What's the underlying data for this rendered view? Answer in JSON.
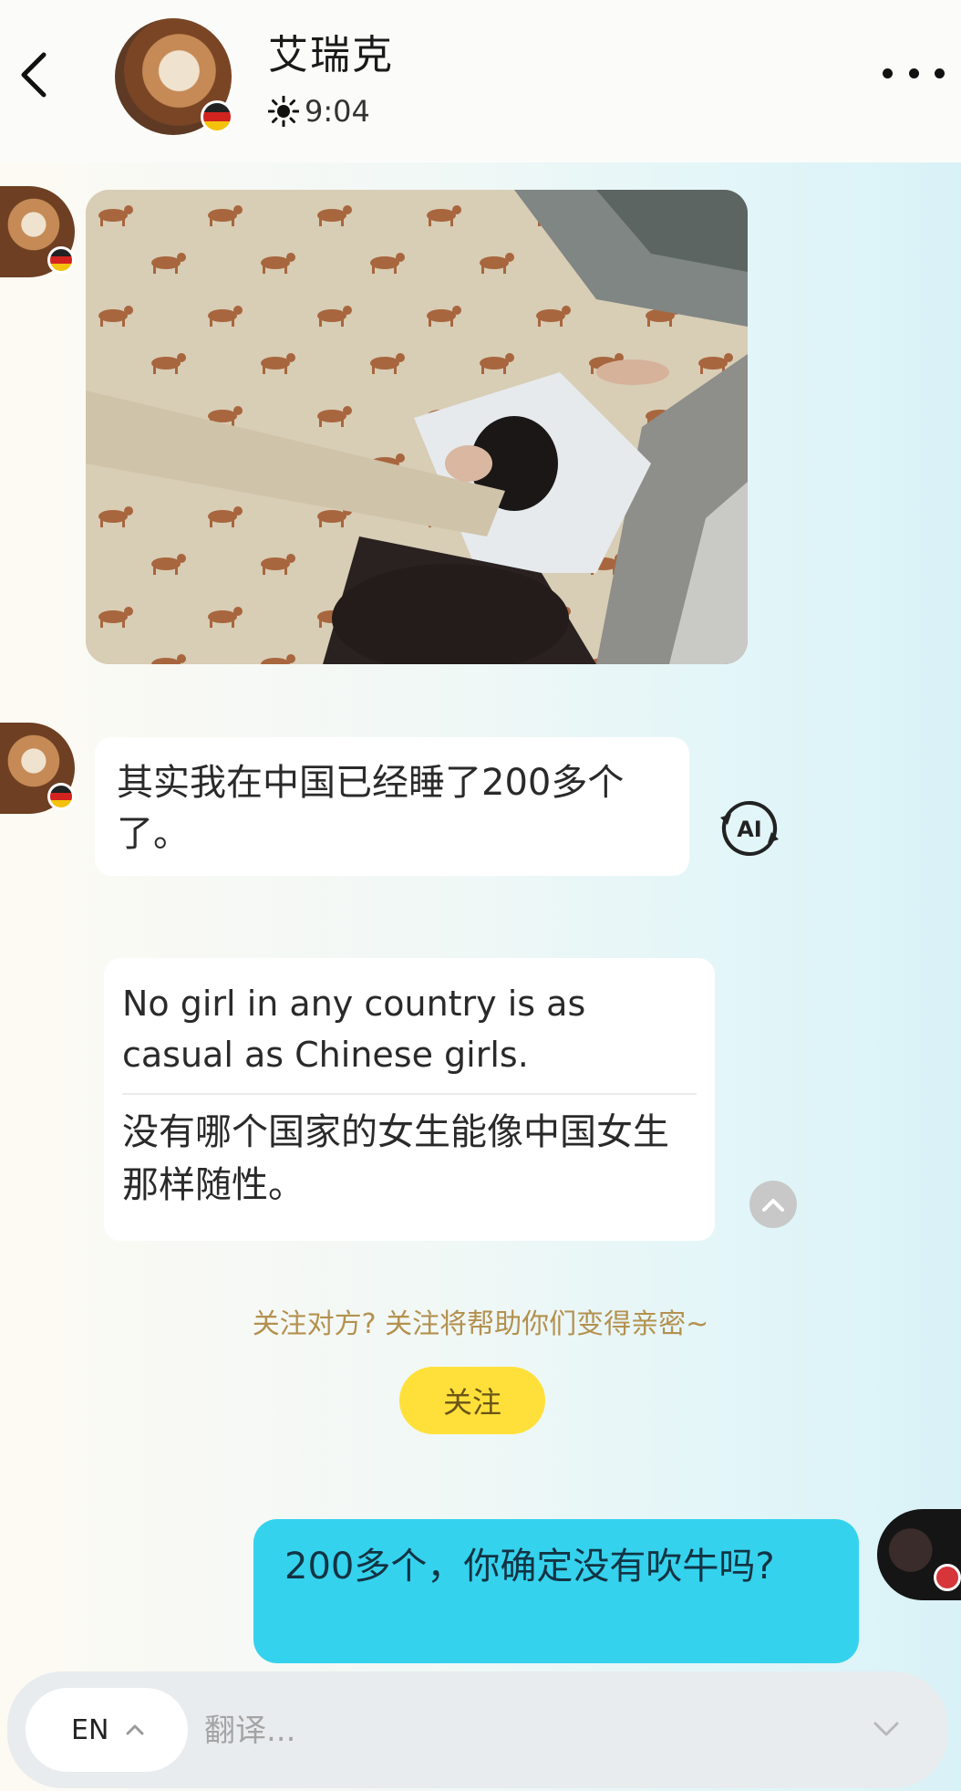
{
  "header": {
    "contact_name": "艾瑞克",
    "time": "9:04",
    "icons": {
      "back": "chevron-left-icon",
      "weather": "sun-icon",
      "more": "more-dots-icon"
    }
  },
  "messages": {
    "photo": {
      "icon": "photo-image"
    },
    "text_1": "其实我在中国已经睡了200多个了。",
    "ai_icon_text": "AI",
    "translation": {
      "english": "No girl in any country is as casual as Chinese girls.",
      "chinese": "没有哪个国家的女生能像中国女生那样随性。"
    },
    "my_message": "200多个，你确定没有吹牛吗?"
  },
  "follow": {
    "tip": "关注对方? 关注将帮助你们变得亲密~",
    "button_label": "关注"
  },
  "input_bar": {
    "language": "EN",
    "placeholder": "翻译..."
  },
  "colors": {
    "my_bubble": "#35d2ee",
    "follow_button": "#ffe03a",
    "follow_tip": "#b4914f"
  }
}
